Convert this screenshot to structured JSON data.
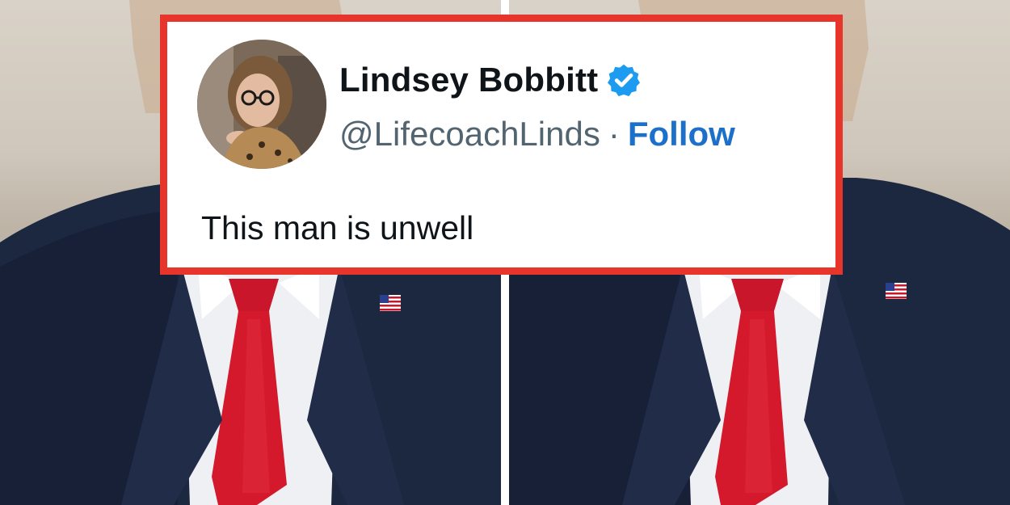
{
  "tweet": {
    "author_name": "Lindsey Bobbitt",
    "verified": true,
    "handle": "@LifecoachLinds",
    "separator": "·",
    "follow_label": "Follow",
    "text": "This man is unwell"
  },
  "colors": {
    "frame_border": "#e8352b",
    "follow_link": "#1d70c9",
    "verified_badge": "#1d9bf0",
    "suit": "#1c2740",
    "tie": "#d3192b",
    "shirt": "#eef0f3"
  },
  "icons": {
    "verified": "verified-badge-icon",
    "flag_pin": "flag-pin-icon"
  },
  "photos": {
    "count": 2,
    "subject": "man in navy suit, white shirt and red tie with flag lapel pin"
  }
}
